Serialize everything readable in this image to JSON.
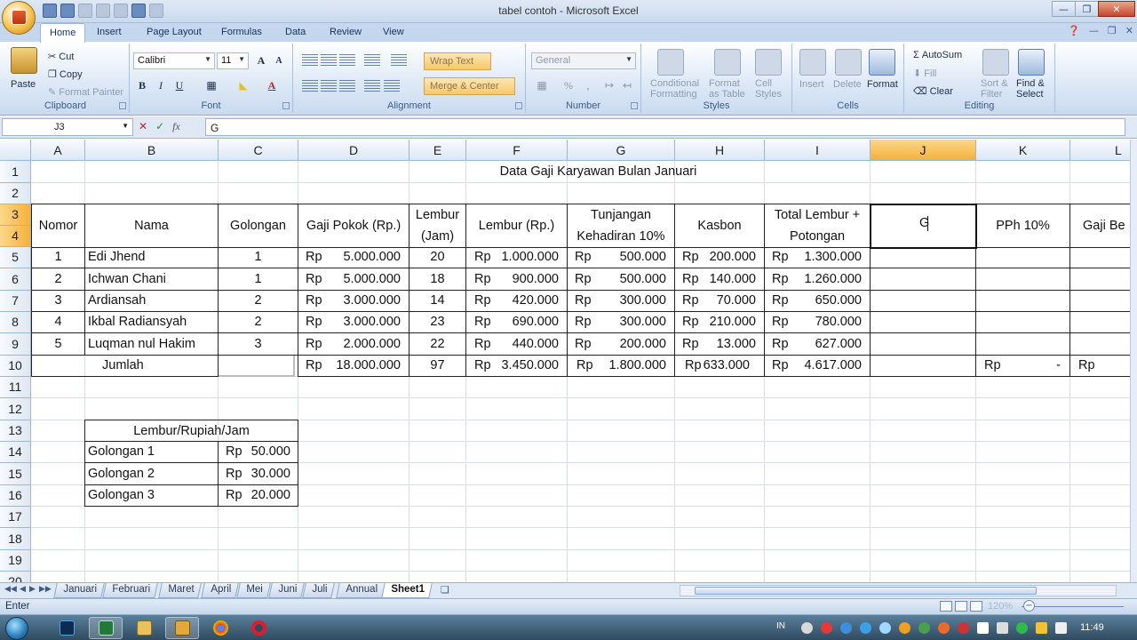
{
  "window": {
    "title": "tabel contoh - Microsoft Excel"
  },
  "ribbon": {
    "tabs": [
      "Home",
      "Insert",
      "Page Layout",
      "Formulas",
      "Data",
      "Review",
      "View"
    ],
    "clipboard": {
      "paste": "Paste",
      "cut": "Cut",
      "copy": "Copy",
      "format_painter": "Format Painter",
      "label": "Clipboard"
    },
    "font": {
      "name": "Calibri",
      "size": "11",
      "grow": "A",
      "shrink": "A",
      "bold": "B",
      "italic": "I",
      "underline": "U",
      "color_letter": "A",
      "label": "Font"
    },
    "alignment": {
      "wrap_text": "Wrap Text",
      "merge_center": "Merge & Center",
      "label": "Alignment"
    },
    "number": {
      "format": "General",
      "percent": "%",
      "label": "Number"
    },
    "styles": {
      "conditional": "Conditional",
      "formatting": "Formatting",
      "format_as": "Format",
      "as_table": "as Table",
      "cell": "Cell",
      "cell_styles": "Styles",
      "label": "Styles"
    },
    "cells": {
      "insert": "Insert",
      "delete": "Delete",
      "format": "Format",
      "label": "Cells"
    },
    "editing": {
      "autosum": "AutoSum",
      "fill": "Fill",
      "clear": "Clear",
      "sort": "Sort &",
      "filter": "Filter",
      "find": "Find &",
      "select": "Select",
      "label": "Editing"
    }
  },
  "formula_bar": {
    "name_box": "J3",
    "fx": "fx",
    "value": "G"
  },
  "grid": {
    "columns": [
      "A",
      "B",
      "C",
      "D",
      "E",
      "F",
      "G",
      "H",
      "I",
      "J",
      "K",
      "L"
    ],
    "selected_column": "J",
    "rows": [
      "1",
      "2",
      "3",
      "4",
      "5",
      "6",
      "7",
      "8",
      "9",
      "10",
      "11",
      "12",
      "13",
      "14",
      "15",
      "16",
      "17",
      "18",
      "19",
      "20"
    ],
    "selected_rows": [
      "3",
      "4"
    ]
  },
  "sheet": {
    "title": "Data Gaji Karyawan Bulan Januari",
    "headers": {
      "nomor": "Nomor",
      "nama": "Nama",
      "golongan": "Golongan",
      "gaji_pokok": "Gaji Pokok (Rp.)",
      "lembur_jam_1": "Lembur",
      "lembur_jam_2": "(Jam)",
      "lembur_rp": "Lembur (Rp.)",
      "tunjangan_1": "Tunjangan",
      "tunjangan_2": "Kehadiran 10%",
      "kasbon": "Kasbon",
      "total_1": "Total Lembur +",
      "total_2": "Potongan",
      "pph": "PPh 10%",
      "gaji_bersih": "Gaji Be"
    },
    "active_cell_text": "G",
    "rows": [
      {
        "no": "1",
        "nama": "Edi Jhend",
        "gol": "1",
        "gaji_rp": "Rp",
        "gaji": "5.000.000",
        "jam": "20",
        "lembur_rp": "Rp",
        "lembur": "1.000.000",
        "tunj_rp": "Rp",
        "tunj": "500.000",
        "kas_rp": "Rp",
        "kas": "200.000",
        "tot_rp": "Rp",
        "tot": "1.300.000"
      },
      {
        "no": "2",
        "nama": "Ichwan Chani",
        "gol": "1",
        "gaji_rp": "Rp",
        "gaji": "5.000.000",
        "jam": "18",
        "lembur_rp": "Rp",
        "lembur": "900.000",
        "tunj_rp": "Rp",
        "tunj": "500.000",
        "kas_rp": "Rp",
        "kas": "140.000",
        "tot_rp": "Rp",
        "tot": "1.260.000"
      },
      {
        "no": "3",
        "nama": "Ardiansah",
        "gol": "2",
        "gaji_rp": "Rp",
        "gaji": "3.000.000",
        "jam": "14",
        "lembur_rp": "Rp",
        "lembur": "420.000",
        "tunj_rp": "Rp",
        "tunj": "300.000",
        "kas_rp": "Rp",
        "kas": "70.000",
        "tot_rp": "Rp",
        "tot": "650.000"
      },
      {
        "no": "4",
        "nama": "Ikbal Radiansyah",
        "gol": "2",
        "gaji_rp": "Rp",
        "gaji": "3.000.000",
        "jam": "23",
        "lembur_rp": "Rp",
        "lembur": "690.000",
        "tunj_rp": "Rp",
        "tunj": "300.000",
        "kas_rp": "Rp",
        "kas": "210.000",
        "tot_rp": "Rp",
        "tot": "780.000"
      },
      {
        "no": "5",
        "nama": "Luqman nul Hakim",
        "gol": "3",
        "gaji_rp": "Rp",
        "gaji": "2.000.000",
        "jam": "22",
        "lembur_rp": "Rp",
        "lembur": "440.000",
        "tunj_rp": "Rp",
        "tunj": "200.000",
        "kas_rp": "Rp",
        "kas": "13.000",
        "tot_rp": "Rp",
        "tot": "627.000"
      }
    ],
    "jumlah": {
      "label": "Jumlah",
      "gaji_rp": "Rp",
      "gaji": "18.000.000",
      "jam": "97",
      "lembur_rp": "Rp",
      "lembur": "3.450.000",
      "tunj_rp": "Rp",
      "tunj": "1.800.000",
      "kas_rp": "Rp",
      "kas": "633.000",
      "tot_rp": "Rp",
      "tot": "4.617.000",
      "pph_rp": "Rp",
      "pph": "-",
      "bersih_rp": "Rp"
    },
    "lembur_table": {
      "title": "Lembur/Rupiah/Jam",
      "rows": [
        {
          "gol": "Golongan 1",
          "rp": "Rp",
          "val": "50.000"
        },
        {
          "gol": "Golongan 2",
          "rp": "Rp",
          "val": "30.000"
        },
        {
          "gol": "Golongan 3",
          "rp": "Rp",
          "val": "20.000"
        }
      ]
    }
  },
  "sheet_tabs": [
    "Januari",
    "Februari",
    "Maret",
    "April",
    "Mei",
    "Juni",
    "Juli",
    "Annual",
    "Sheet1"
  ],
  "active_sheet": "Sheet1",
  "status": {
    "mode": "Enter",
    "zoom": "120%"
  },
  "taskbar": {
    "lang": "IN",
    "time": "11:49"
  },
  "colors": {
    "ribbon_bg": "#dce8f6",
    "selected_header": "#f6b13b",
    "excel_green": "#1f7a3c"
  }
}
